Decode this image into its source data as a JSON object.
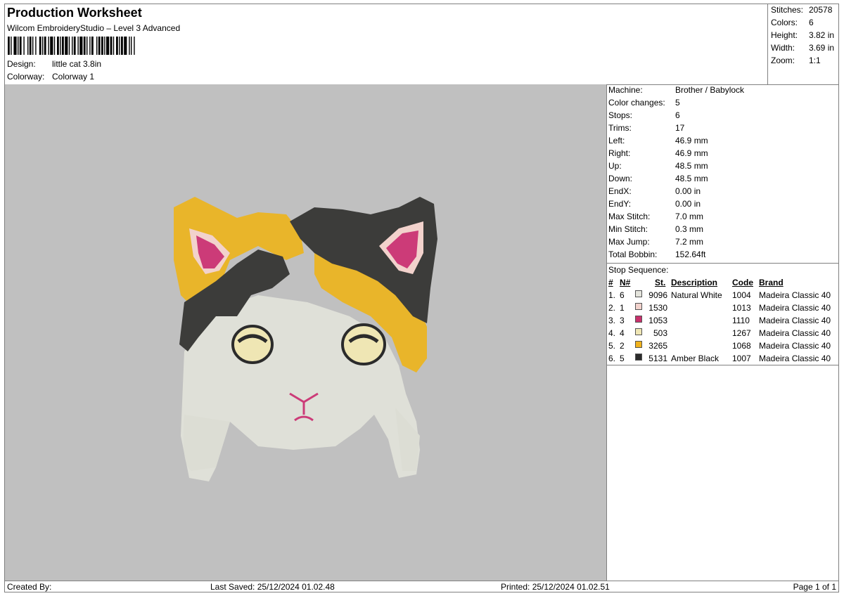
{
  "header": {
    "title": "Production Worksheet",
    "software": "Wilcom EmbroideryStudio – Level 3 Advanced",
    "design_label": "Design:",
    "design_value": "little cat 3.8in",
    "colorway_label": "Colorway:",
    "colorway_value": "Colorway 1"
  },
  "summary": [
    {
      "label": "Stitches:",
      "value": "20578"
    },
    {
      "label": "Colors:",
      "value": "6"
    },
    {
      "label": "Height:",
      "value": "3.82 in"
    },
    {
      "label": "Width:",
      "value": "3.69 in"
    },
    {
      "label": "Zoom:",
      "value": "1:1"
    }
  ],
  "machine_info": [
    {
      "label": "Machine:",
      "value": "Brother / Babylock"
    },
    {
      "label": "Color changes:",
      "value": "5"
    },
    {
      "label": "Stops:",
      "value": "6"
    },
    {
      "label": "Trims:",
      "value": "17"
    },
    {
      "label": "Left:",
      "value": "46.9 mm"
    },
    {
      "label": "Right:",
      "value": "46.9 mm"
    },
    {
      "label": "Up:",
      "value": "48.5 mm"
    },
    {
      "label": "Down:",
      "value": "48.5 mm"
    },
    {
      "label": "EndX:",
      "value": "0.00 in"
    },
    {
      "label": "EndY:",
      "value": "0.00 in"
    },
    {
      "label": "Max Stitch:",
      "value": "7.0 mm"
    },
    {
      "label": "Min Stitch:",
      "value": "0.3 mm"
    },
    {
      "label": "Max Jump:",
      "value": "7.2 mm"
    },
    {
      "label": "Total Bobbin:",
      "value": "152.64ft"
    }
  ],
  "stop_sequence": {
    "title": "Stop Sequence:",
    "headers": {
      "num": "#",
      "needle": "N#",
      "st": "St.",
      "description": "Description",
      "code": "Code",
      "brand": "Brand"
    },
    "rows": [
      {
        "num": "1.",
        "needle": "6",
        "color": "#e4e4dc",
        "st": "9096",
        "description": "Natural White",
        "code": "1004",
        "brand": "Madeira Classic 40"
      },
      {
        "num": "2.",
        "needle": "1",
        "color": "#f2d2cc",
        "st": "1530",
        "description": "",
        "code": "1013",
        "brand": "Madeira Classic 40"
      },
      {
        "num": "3.",
        "needle": "3",
        "color": "#c8306c",
        "st": "1053",
        "description": "",
        "code": "1110",
        "brand": "Madeira Classic 40"
      },
      {
        "num": "4.",
        "needle": "4",
        "color": "#efe6b4",
        "st": "503",
        "description": "",
        "code": "1267",
        "brand": "Madeira Classic 40"
      },
      {
        "num": "5.",
        "needle": "2",
        "color": "#f0b21c",
        "st": "3265",
        "description": "",
        "code": "1068",
        "brand": "Madeira Classic 40"
      },
      {
        "num": "6.",
        "needle": "5",
        "color": "#2b2b2b",
        "st": "5131",
        "description": "Amber Black",
        "code": "1007",
        "brand": "Madeira Classic 40"
      }
    ]
  },
  "footer": {
    "created_by": "Created By:",
    "last_saved": "Last Saved: 25/12/2024 01.02.48",
    "printed": "Printed: 25/12/2024 01.02.51",
    "page": "Page 1 of 1"
  },
  "preview": {
    "background_color": "#c0c0c0",
    "thread_colors": {
      "white": "#dfe0d8",
      "gray_dark": "#3c3c3a",
      "gold": "#e9b52a",
      "pink": "#cc3b78",
      "pale_pink": "#f2d2cc",
      "cream": "#efe6b4"
    }
  }
}
